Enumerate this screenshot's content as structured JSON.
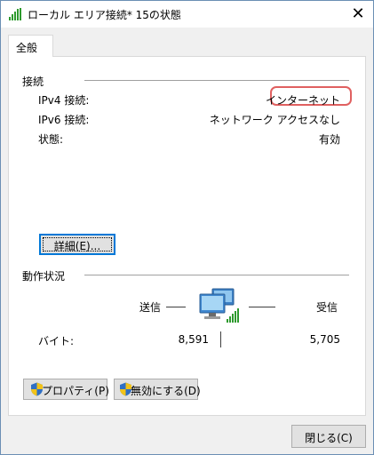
{
  "window": {
    "title": "ローカル エリア接続* 15の状態",
    "close_glyph": "✕"
  },
  "tabs": [
    {
      "label": "全般",
      "selected": true
    }
  ],
  "connection": {
    "group_title": "接続",
    "rows": [
      {
        "label": "IPv4 接続:",
        "value": "インターネット",
        "highlighted": true
      },
      {
        "label": "IPv6 接続:",
        "value": "ネットワーク アクセスなし"
      },
      {
        "label": "状態:",
        "value": "有効"
      }
    ],
    "details_button": "詳細(E)..."
  },
  "activity": {
    "group_title": "動作状況",
    "sent_label": "送信",
    "received_label": "受信",
    "bytes_label": "バイト:",
    "bytes_sent": "8,591",
    "bytes_received": "5,705",
    "icon": "network-computers-icon"
  },
  "buttons": {
    "properties": "プロパティ(P)",
    "disable": "無効にする(D)",
    "close": "閉じる(C)"
  },
  "colors": {
    "highlight_border": "#e06060",
    "focus_blue": "#0078d7",
    "signal_green": "#2e9a2e"
  }
}
